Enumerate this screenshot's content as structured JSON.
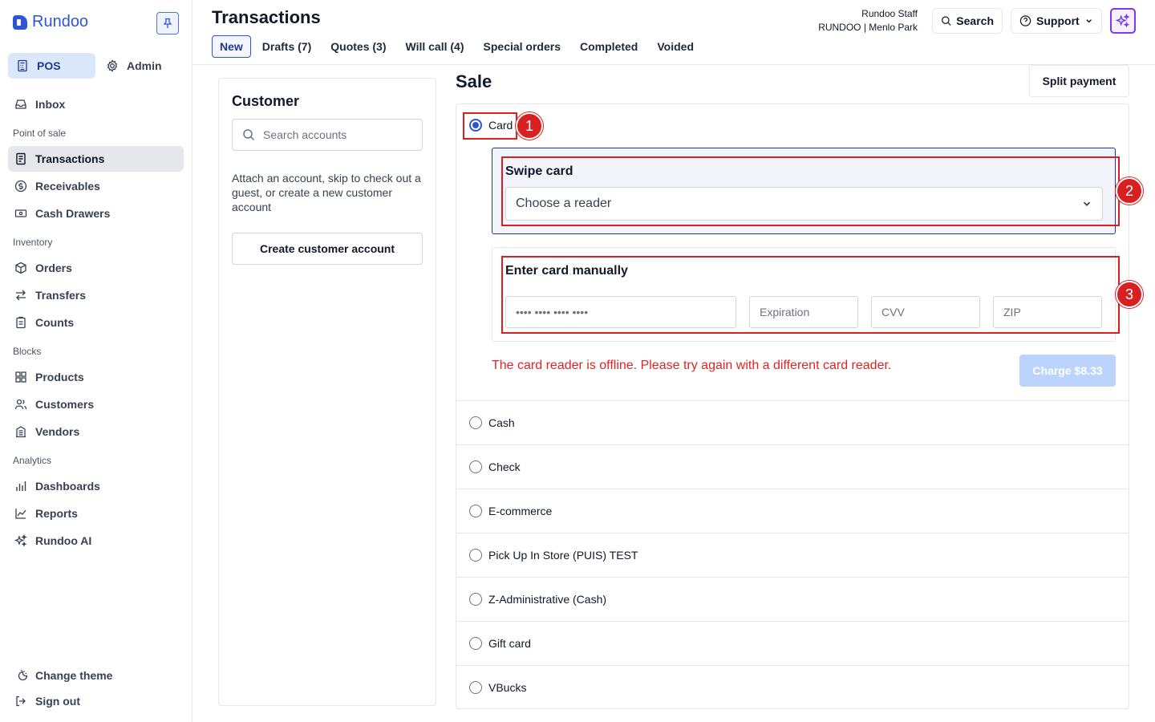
{
  "app": {
    "brand": "Rundoo"
  },
  "sidebar": {
    "modes": [
      {
        "label": "POS",
        "icon": "pos-icon"
      },
      {
        "label": "Admin",
        "icon": "gear-icon"
      }
    ],
    "inbox": "Inbox",
    "sections": [
      {
        "title": "Point of sale",
        "items": [
          "Transactions",
          "Receivables",
          "Cash Drawers"
        ]
      },
      {
        "title": "Inventory",
        "items": [
          "Orders",
          "Transfers",
          "Counts"
        ]
      },
      {
        "title": "Blocks",
        "items": [
          "Products",
          "Customers",
          "Vendors"
        ]
      },
      {
        "title": "Analytics",
        "items": [
          "Dashboards",
          "Reports",
          "Rundoo AI"
        ]
      }
    ],
    "footer": {
      "change_theme": "Change theme",
      "sign_out": "Sign out"
    }
  },
  "header": {
    "title": "Transactions",
    "tabs": [
      "New",
      "Drafts (7)",
      "Quotes (3)",
      "Will call (4)",
      "Special orders",
      "Completed",
      "Voided"
    ],
    "active_tab": "New",
    "user_name": "Rundoo Staff",
    "store": "RUNDOO | Menlo Park",
    "search_label": "Search",
    "support_label": "Support"
  },
  "customer": {
    "title": "Customer",
    "search_placeholder": "Search accounts",
    "help_text": "Attach an account, skip to check out a guest, or create a new customer account",
    "create_button": "Create customer account"
  },
  "sale": {
    "title": "Sale",
    "split_payment": "Split payment",
    "selected_method": "Card",
    "card_label": "Card",
    "swipe_title": "Swipe card",
    "reader_placeholder": "Choose a reader",
    "manual_title": "Enter card manually",
    "card_number_placeholder": "•••• •••• •••• ••••",
    "expiration_placeholder": "Expiration",
    "cvv_placeholder": "CVV",
    "zip_placeholder": "ZIP",
    "error": "The card reader is offline. Please try again with a different card reader.",
    "charge_button": "Charge $8.33",
    "methods": [
      "Cash",
      "Check",
      "E-commerce",
      "Pick Up In Store (PUIS) TEST",
      "Z-Administrative (Cash)",
      "Gift card",
      "VBucks"
    ]
  },
  "annotations": [
    "1",
    "2",
    "3"
  ],
  "colors": {
    "accent": "#2d55d6",
    "error": "#dc2626",
    "annotation": "#d92020",
    "ai": "#7c3aed"
  }
}
